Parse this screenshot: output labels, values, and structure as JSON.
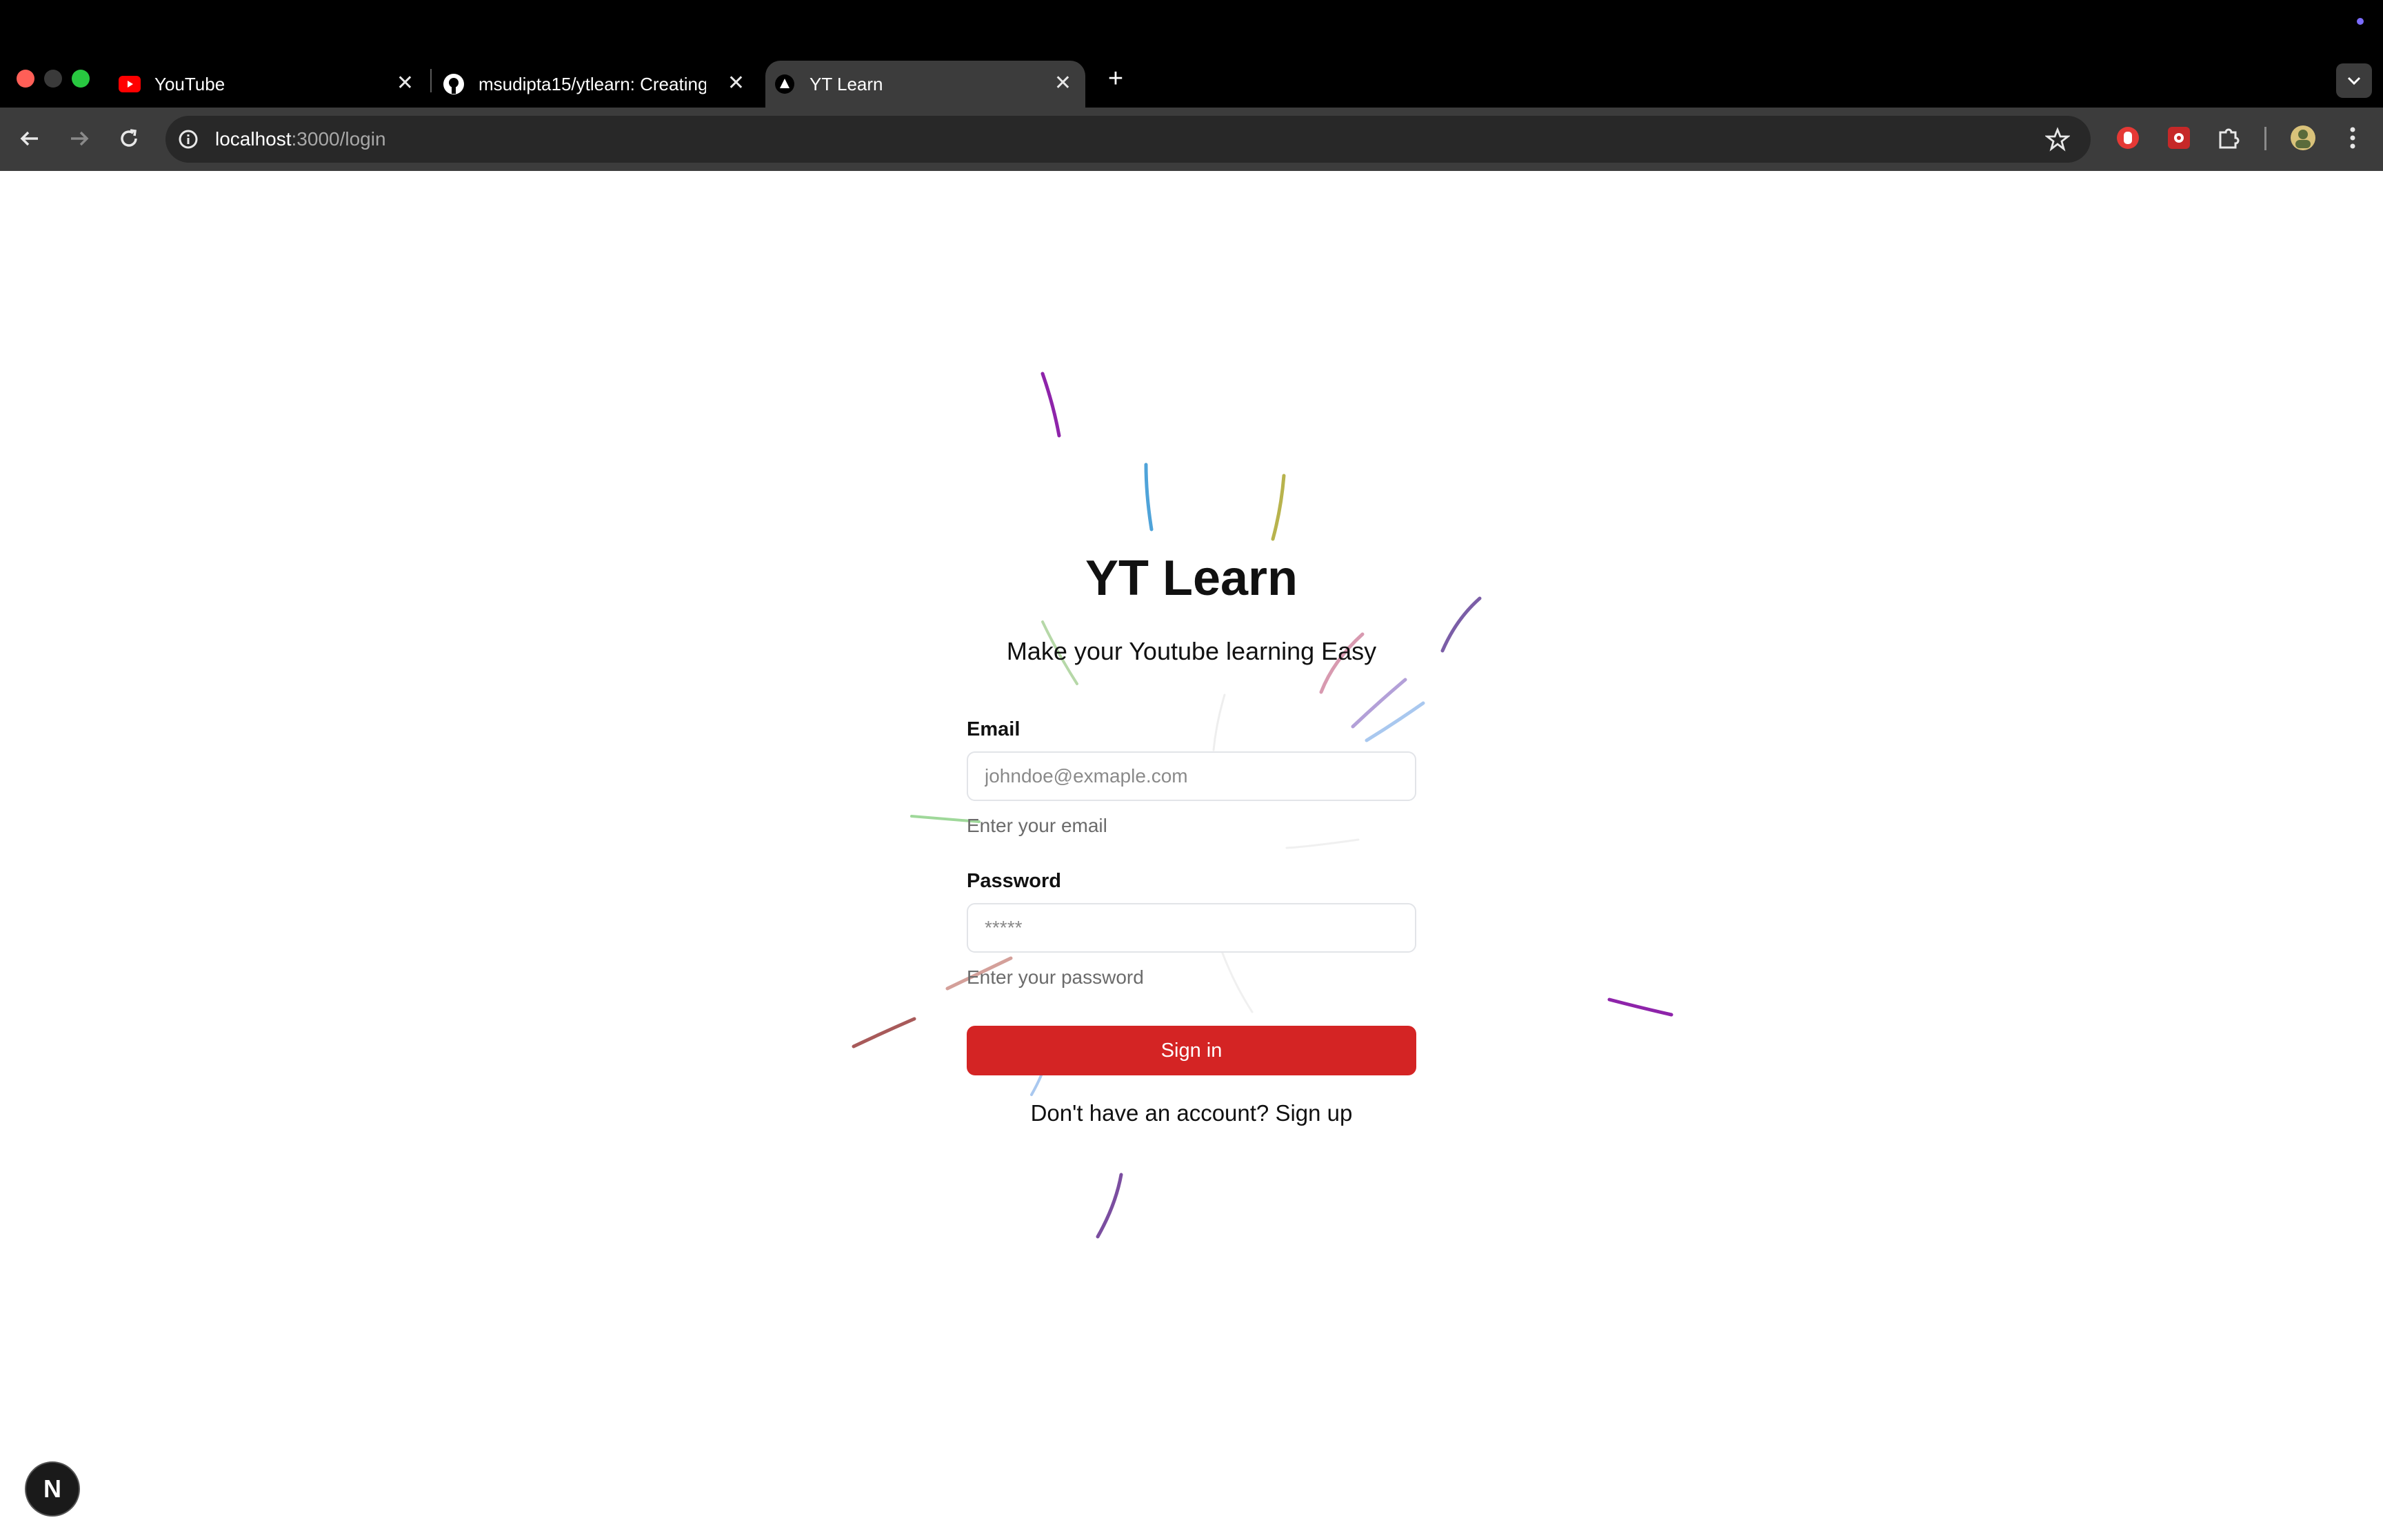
{
  "browser": {
    "tabs": [
      {
        "label": "YouTube",
        "icon": "youtube-icon"
      },
      {
        "label": "msudipta15/ytlearn: Creating",
        "icon": "github-icon"
      },
      {
        "label": "YT Learn",
        "icon": "triangle-icon"
      }
    ],
    "new_tab": "+",
    "url_host": "localhost",
    "url_path": ":3000/login"
  },
  "login": {
    "title": "YT Learn",
    "subtitle": "Make your Youtube learning Easy",
    "email_label": "Email",
    "email_placeholder": "johndoe@exmaple.com",
    "email_hint": "Enter your email",
    "password_label": "Password",
    "password_placeholder": "*****",
    "password_hint": "Enter your password",
    "signin_label": "Sign in",
    "signup_prompt": "Don't have an account?",
    "signup_link": "Sign up"
  },
  "badge": {
    "letter": "N"
  },
  "colors": {
    "accent": "#d42424",
    "chrome_bg": "#000000",
    "toolbar_bg": "#3c3c3c"
  }
}
